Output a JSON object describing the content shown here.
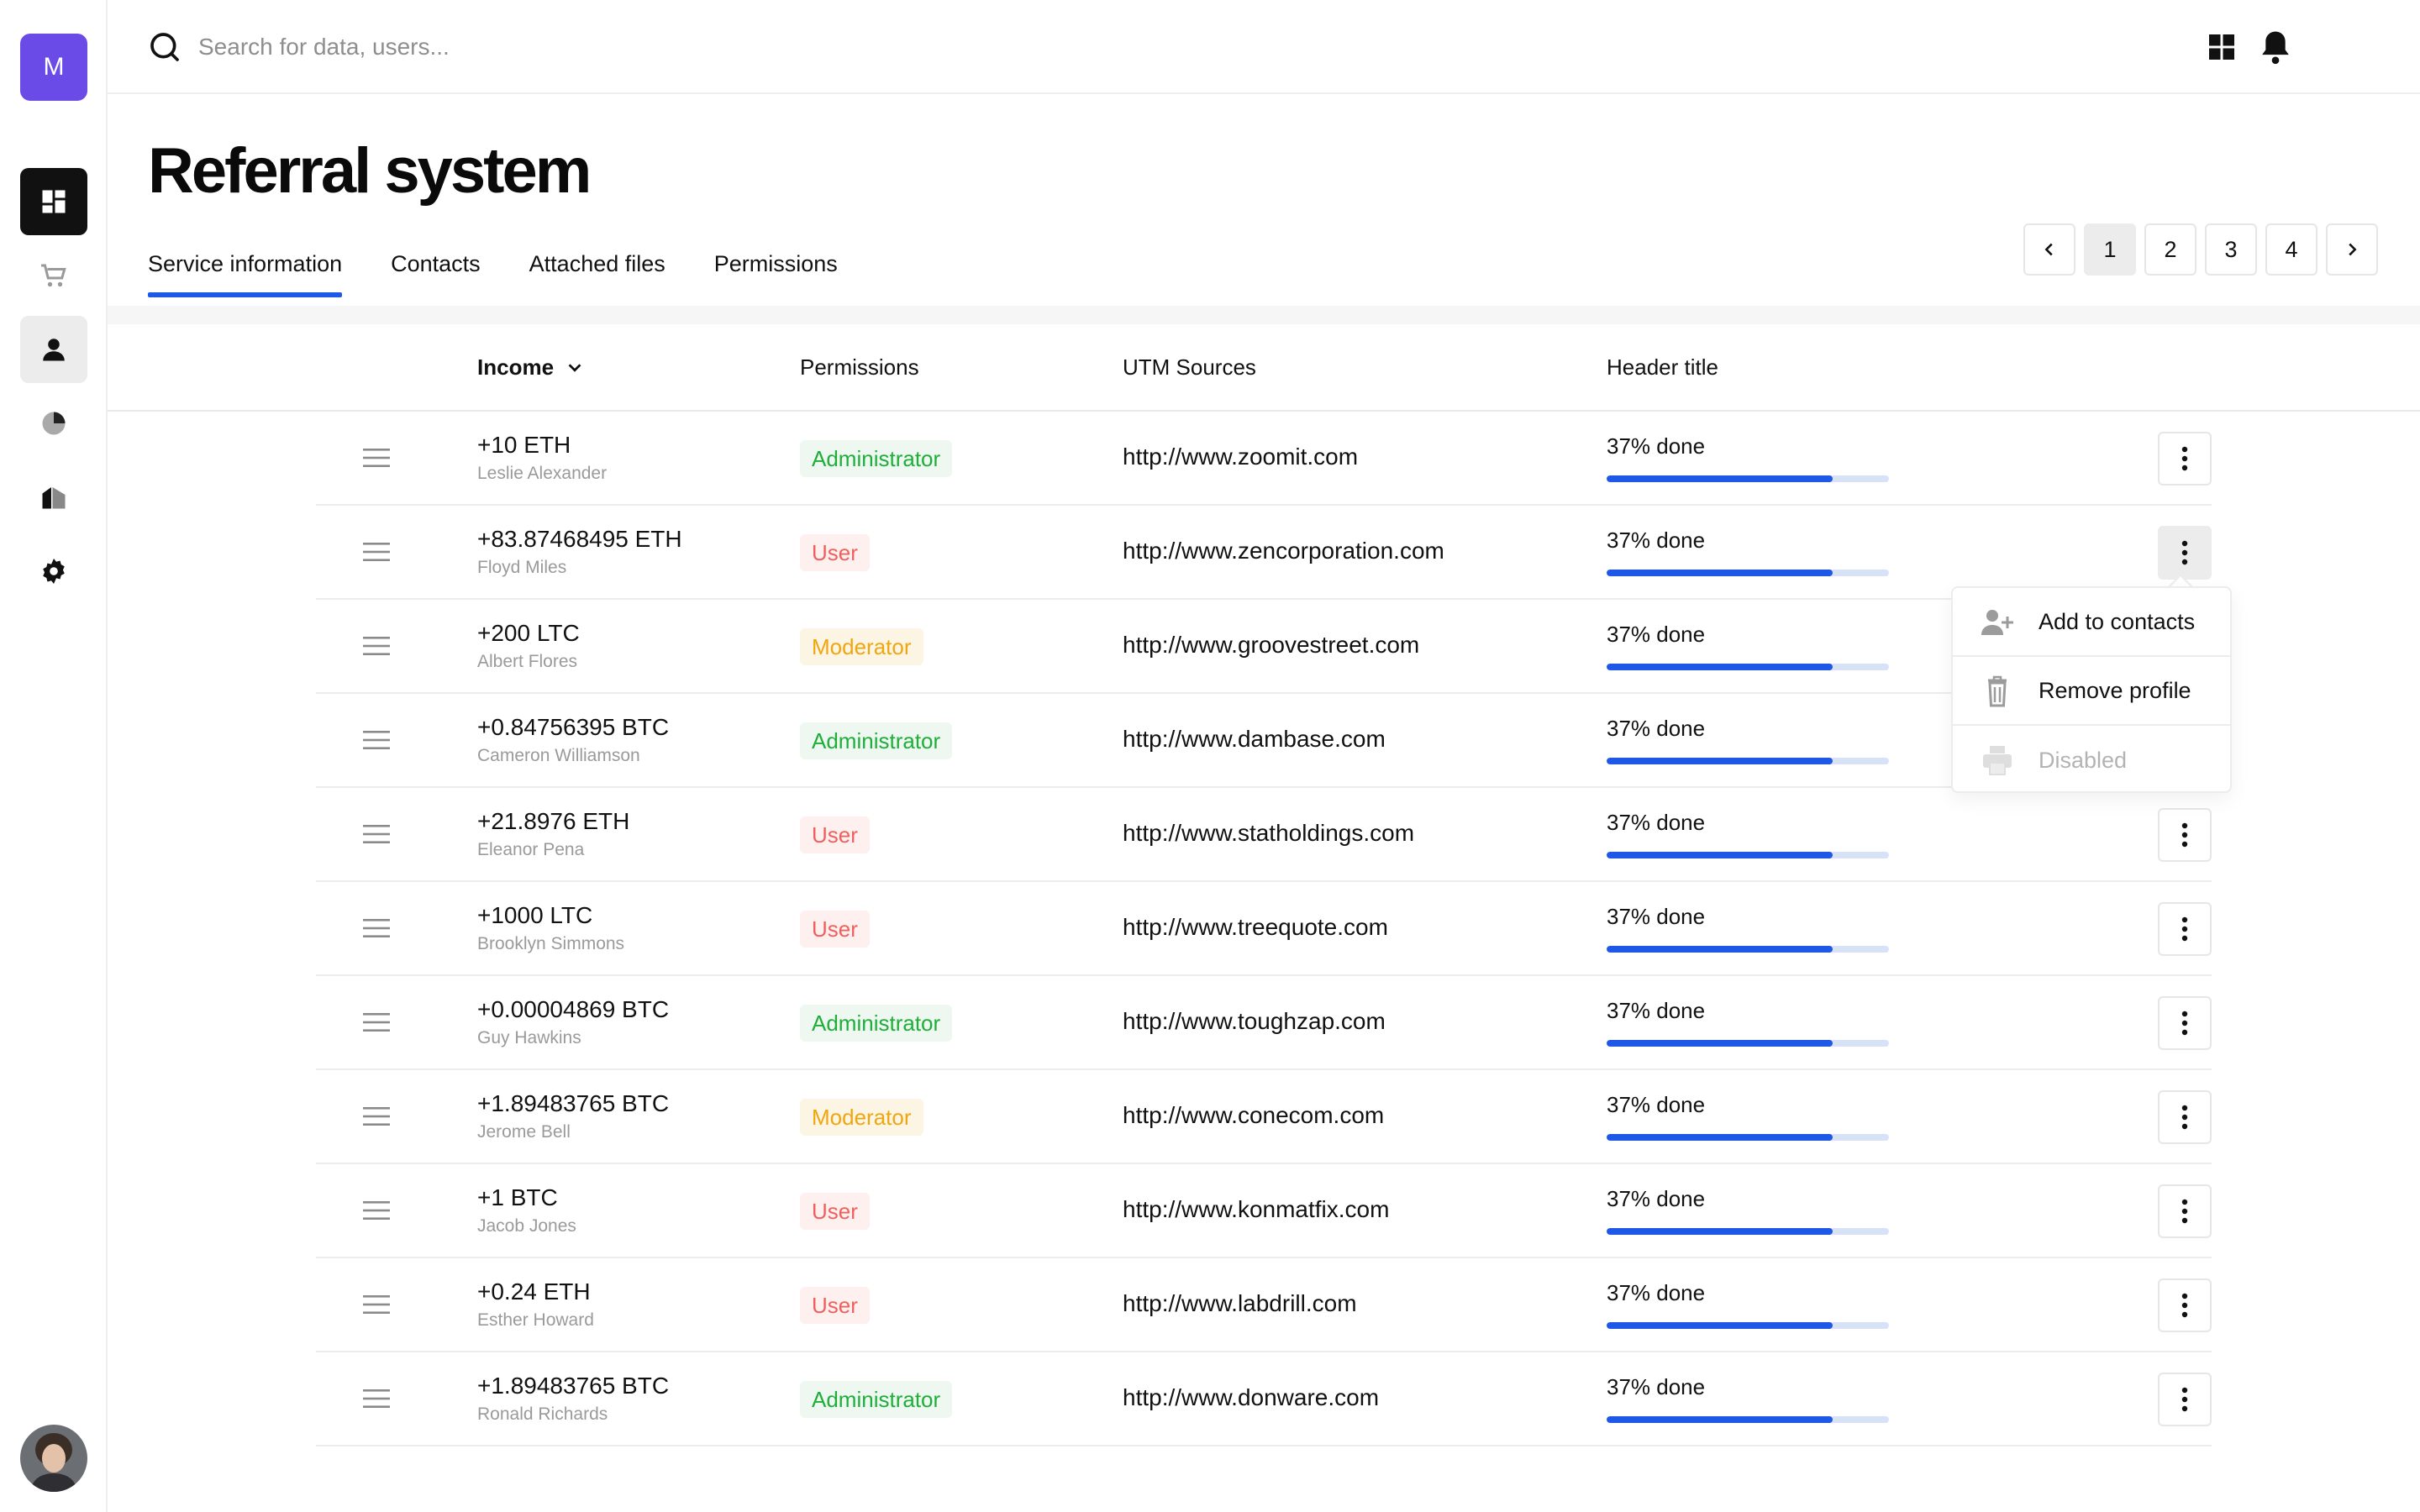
{
  "app": {
    "logo_letter": "M",
    "page_title": "Referral system"
  },
  "search": {
    "placeholder": "Search for data, users..."
  },
  "tabs": [
    {
      "label": "Service information",
      "active": true
    },
    {
      "label": "Contacts",
      "active": false
    },
    {
      "label": "Attached files",
      "active": false
    },
    {
      "label": "Permissions",
      "active": false
    }
  ],
  "pagination": {
    "pages": [
      "1",
      "2",
      "3",
      "4"
    ],
    "current": "1"
  },
  "table": {
    "headers": {
      "income": "Income",
      "permissions": "Permissions",
      "utm": "UTM Sources",
      "header_title": "Header title"
    },
    "rows": [
      {
        "income": "+10 ETH",
        "name": "Leslie Alexander",
        "permission": "Administrator",
        "utm": "http://www.zoomit.com",
        "progress_label": "37% done",
        "progress": 0.8
      },
      {
        "income": "+83.87468495 ETH",
        "name": "Floyd Miles",
        "permission": "User",
        "utm": "http://www.zencorporation.com",
        "progress_label": "37% done",
        "progress": 0.8
      },
      {
        "income": "+200 LTC",
        "name": "Albert Flores",
        "permission": "Moderator",
        "utm": "http://www.groovestreet.com",
        "progress_label": "37% done",
        "progress": 0.8
      },
      {
        "income": "+0.84756395 BTC",
        "name": "Cameron Williamson",
        "permission": "Administrator",
        "utm": "http://www.dambase.com",
        "progress_label": "37% done",
        "progress": 0.8
      },
      {
        "income": "+21.8976 ETH",
        "name": "Eleanor Pena",
        "permission": "User",
        "utm": "http://www.statholdings.com",
        "progress_label": "37% done",
        "progress": 0.8
      },
      {
        "income": "+1000 LTC",
        "name": "Brooklyn Simmons",
        "permission": "User",
        "utm": "http://www.treequote.com",
        "progress_label": "37% done",
        "progress": 0.8
      },
      {
        "income": "+0.00004869 BTC",
        "name": "Guy Hawkins",
        "permission": "Administrator",
        "utm": "http://www.toughzap.com",
        "progress_label": "37% done",
        "progress": 0.8
      },
      {
        "income": "+1.89483765 BTC",
        "name": "Jerome Bell",
        "permission": "Moderator",
        "utm": "http://www.conecom.com",
        "progress_label": "37% done",
        "progress": 0.8
      },
      {
        "income": "+1 BTC",
        "name": "Jacob Jones",
        "permission": "User",
        "utm": "http://www.konmatfix.com",
        "progress_label": "37% done",
        "progress": 0.8
      },
      {
        "income": "+0.24 ETH",
        "name": "Esther Howard",
        "permission": "User",
        "utm": "http://www.labdrill.com",
        "progress_label": "37% done",
        "progress": 0.8
      },
      {
        "income": "+1.89483765 BTC",
        "name": "Ronald Richards",
        "permission": "Administrator",
        "utm": "http://www.donware.com",
        "progress_label": "37% done",
        "progress": 0.8
      }
    ]
  },
  "context_menu": {
    "open_row": 1,
    "items": [
      {
        "label": "Add to contacts",
        "icon": "user-plus-icon",
        "disabled": false
      },
      {
        "label": "Remove profile",
        "icon": "trash-icon",
        "disabled": false
      },
      {
        "label": "Disabled",
        "icon": "printer-icon",
        "disabled": true
      }
    ]
  },
  "colors": {
    "accent": "#1e58e6",
    "logo": "#6a4be8",
    "admin": "#1fae3a",
    "user": "#f0605c",
    "moderator": "#efa610"
  },
  "sidebar": {
    "items": [
      {
        "icon": "dashboard-icon",
        "state": "active"
      },
      {
        "icon": "cart-icon",
        "state": "normal"
      },
      {
        "icon": "user-icon",
        "state": "selected"
      },
      {
        "icon": "pie-chart-icon",
        "state": "normal"
      },
      {
        "icon": "building-icon",
        "state": "normal"
      },
      {
        "icon": "gear-icon",
        "state": "normal"
      }
    ]
  }
}
